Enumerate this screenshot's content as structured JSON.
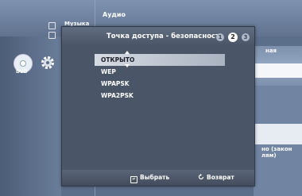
{
  "background": {
    "menu_music": "Музыка",
    "menu_audio": "Аудио",
    "right_label_top": "ная",
    "right_label_bottom": "но (закон\nлям)",
    "dvd_label": "DVD"
  },
  "dialog": {
    "title": "Точка доступа - безопасность",
    "steps": [
      "1",
      "2",
      "3"
    ],
    "current_step": "2",
    "options": [
      "ОТКРЫТО",
      "WEP",
      "WPAPSK",
      "WPA2PSK"
    ],
    "selected_option": "ОТКРЫТО"
  },
  "footer": {
    "select_label": "Выбрать",
    "back_label": "Возврат"
  }
}
